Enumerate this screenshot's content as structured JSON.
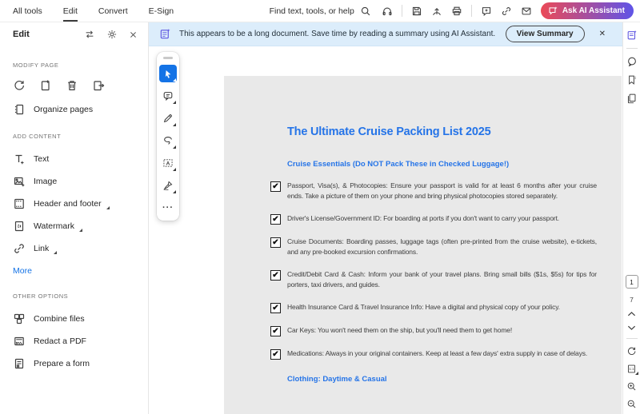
{
  "menubar": {
    "tabs": [
      {
        "label": "All tools",
        "active": false
      },
      {
        "label": "Edit",
        "active": true
      },
      {
        "label": "Convert",
        "active": false
      },
      {
        "label": "E-Sign",
        "active": false
      }
    ],
    "find_label": "Find text, tools, or help",
    "ai_button_label": "Ask AI Assistant"
  },
  "edit_panel": {
    "title": "Edit",
    "modify_section_label": "MODIFY PAGE",
    "organize_pages_label": "Organize pages",
    "add_section_label": "ADD CONTENT",
    "add_items": [
      {
        "label": "Text"
      },
      {
        "label": "Image"
      },
      {
        "label": "Header and footer",
        "has_submenu": true
      },
      {
        "label": "Watermark",
        "has_submenu": true
      },
      {
        "label": "Link",
        "has_submenu": true
      }
    ],
    "more_label": "More",
    "other_section_label": "OTHER OPTIONS",
    "other_items": [
      {
        "label": "Combine files"
      },
      {
        "label": "Redact a PDF"
      },
      {
        "label": "Prepare a form"
      }
    ]
  },
  "banner": {
    "message": "This appears to be a long document. Save time by reading a summary using AI Assistant.",
    "button_label": "View Summary",
    "close_glyph": "✕"
  },
  "vertical_toolbar": {
    "more_glyph": "···"
  },
  "document": {
    "title": "The Ultimate Cruise Packing List 2025",
    "section_heading": "Cruise Essentials (Do NOT Pack These in Checked Luggage!)",
    "check_glyph": "✔",
    "items": [
      {
        "text": "Passport, Visa(s), & Photocopies: Ensure your passport is valid for at least 6 months after your cruise ends. Take a picture of them on your phone and bring physical photocopies stored separately."
      },
      {
        "text": "Driver's License/Government ID: For boarding at ports if you don't want to carry your passport."
      },
      {
        "text": "Cruise Documents: Boarding passes, luggage tags (often pre-printed from the cruise website), e-tickets, and any pre-booked excursion confirmations."
      },
      {
        "text": "Credit/Debit Card & Cash: Inform your bank of your travel plans. Bring small bills ($1s, $5s) for tips for porters, taxi drivers, and guides."
      },
      {
        "text": "Health Insurance Card & Travel Insurance Info: Have a digital and physical copy of your policy."
      },
      {
        "text": "Car Keys: You won't need them on the ship, but you'll need them to get home!"
      },
      {
        "text": "Medications: Always in your original containers. Keep at least a few days' extra supply in case of delays."
      }
    ],
    "next_section_heading": "Clothing: Daytime & Casual"
  },
  "right_rail": {
    "current_page": "1",
    "total_pages": "7"
  },
  "colors": {
    "accent_blue": "#1473e6",
    "document_blue": "#2574e8",
    "banner_bg": "#dcedfb",
    "page_bg": "#e9e9e9",
    "ai_gradient_start": "#eb4a57",
    "ai_gradient_end": "#5f54e8"
  }
}
